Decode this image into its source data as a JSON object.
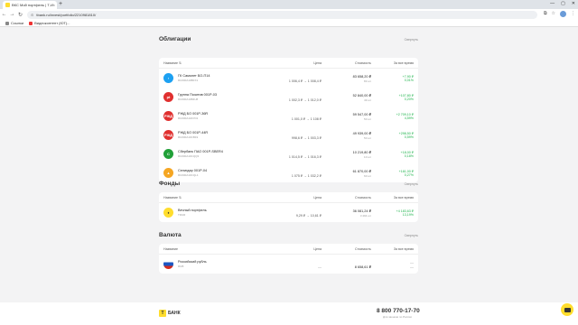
{
  "browser": {
    "tab_title": "ВКС Мой портфель | Т-Инвес",
    "tab_close": "×",
    "new_tab": "+",
    "url": "tbank.ru/invest/portfolio/2210981810/",
    "win_min": "—",
    "win_max": "▢",
    "win_close": "✕",
    "back": "←",
    "forward": "→",
    "reload": "↻",
    "bookmarks": [
      "Ссылки",
      "Видеоконтент (ЮТ)..."
    ]
  },
  "bonds": {
    "title": "Облигации",
    "collapse": "Свернуть",
    "headers": {
      "name": "Название ⇅",
      "price": "Цена",
      "cost": "Стоимость",
      "total": "За все время"
    },
    "rows": [
      {
        "name": "ГК Самолет БО-П14",
        "ticker": "RU000A10BFX1",
        "price": "1 006,4 ₽ → 1 008,4 ₽",
        "cost": "83 658,20 ₽",
        "qty": "83 шт",
        "gain": "+7,90 ₽",
        "pct": "0,01%",
        "logo_color": "#1da1f2",
        "logo_text": "›"
      },
      {
        "name": "Группа Позитив 001Р-03",
        "ticker": "RU000A10B4U8",
        "price": "1 002,3 ₽ → 1 012,0 ₽",
        "cost": "52 840,00 ₽",
        "qty": "49 шт",
        "gain": "+107,80 ₽",
        "pct": "0,20%",
        "logo_color": "#e0302f",
        "logo_text": "pt"
      },
      {
        "name": "РЖД БО 001Р-36R",
        "ticker": "RU000A10AYD1",
        "price": "1 001,0 ₽ → 1 108 ₽",
        "cost": "59 547,00 ₽",
        "qty": "50 шт",
        "gain": "+2 709,10 ₽",
        "pct": "4,59%",
        "logo_color": "#e0302f",
        "logo_text": "РЖД"
      },
      {
        "name": "РЖД БО 001Р-44R",
        "ticker": "RU000A10CB19",
        "price": "998,6 ₽ → 1 003,3 ₽",
        "cost": "49 939,00 ₽",
        "qty": "50 шт",
        "gain": "+298,50 ₽",
        "pct": "0,59%",
        "logo_color": "#e0302f",
        "logo_text": "РЖД"
      },
      {
        "name": "Сбербанк ПАО 001Р-SBER4",
        "ticker": "RU000A10CQQ3",
        "price": "1 014,5 ₽ → 1 016,3 ₽",
        "cost": "10 219,80 ₽",
        "qty": "10 шт",
        "gain": "+18,00 ₽",
        "pct": "0,18%",
        "logo_color": "#21a038",
        "logo_text": "С"
      },
      {
        "name": "Селигдар 001Р-04",
        "ticker": "RU000A10CQL1",
        "price": "1 075 ₽ → 1 032,2 ₽",
        "cost": "61 870,00 ₽",
        "qty": "60 шт",
        "gain": "+161,00 ₽",
        "pct": "0,27%",
        "logo_color": "#f5a623",
        "logo_text": "▲"
      }
    ]
  },
  "funds": {
    "title": "Фонды",
    "collapse": "Свернуть",
    "headers": {
      "name": "Название ⇅",
      "price": "Цена",
      "cost": "Стоимость",
      "total": "За все время"
    },
    "rows": [
      {
        "name": "Вечный портфель",
        "ticker": "TRUR",
        "price": "9,29 ₽ → 10,61 ₽",
        "cost": "36 081,24 ₽",
        "qty": "3 494 шт",
        "gain": "+4 183,63 ₽",
        "pct": "13,19%",
        "logo_color": "#ffdd2d",
        "logo_text": "♦"
      }
    ]
  },
  "currency": {
    "title": "Валюта",
    "collapse": "Свернуть",
    "headers": {
      "name": "Название",
      "price": "Цена",
      "cost": "Стоимость",
      "total": "За все время"
    },
    "rows": [
      {
        "name": "Российский рубль",
        "ticker": "RUB",
        "price": "—",
        "cost": "8 658,61 ₽",
        "gain": "—",
        "pct": "—"
      }
    ]
  },
  "footer": {
    "logo_letter": "Т",
    "logo_word": "БАНК",
    "phone": "8 800 770-17-70",
    "phone_sub": "Для звонков по России"
  }
}
